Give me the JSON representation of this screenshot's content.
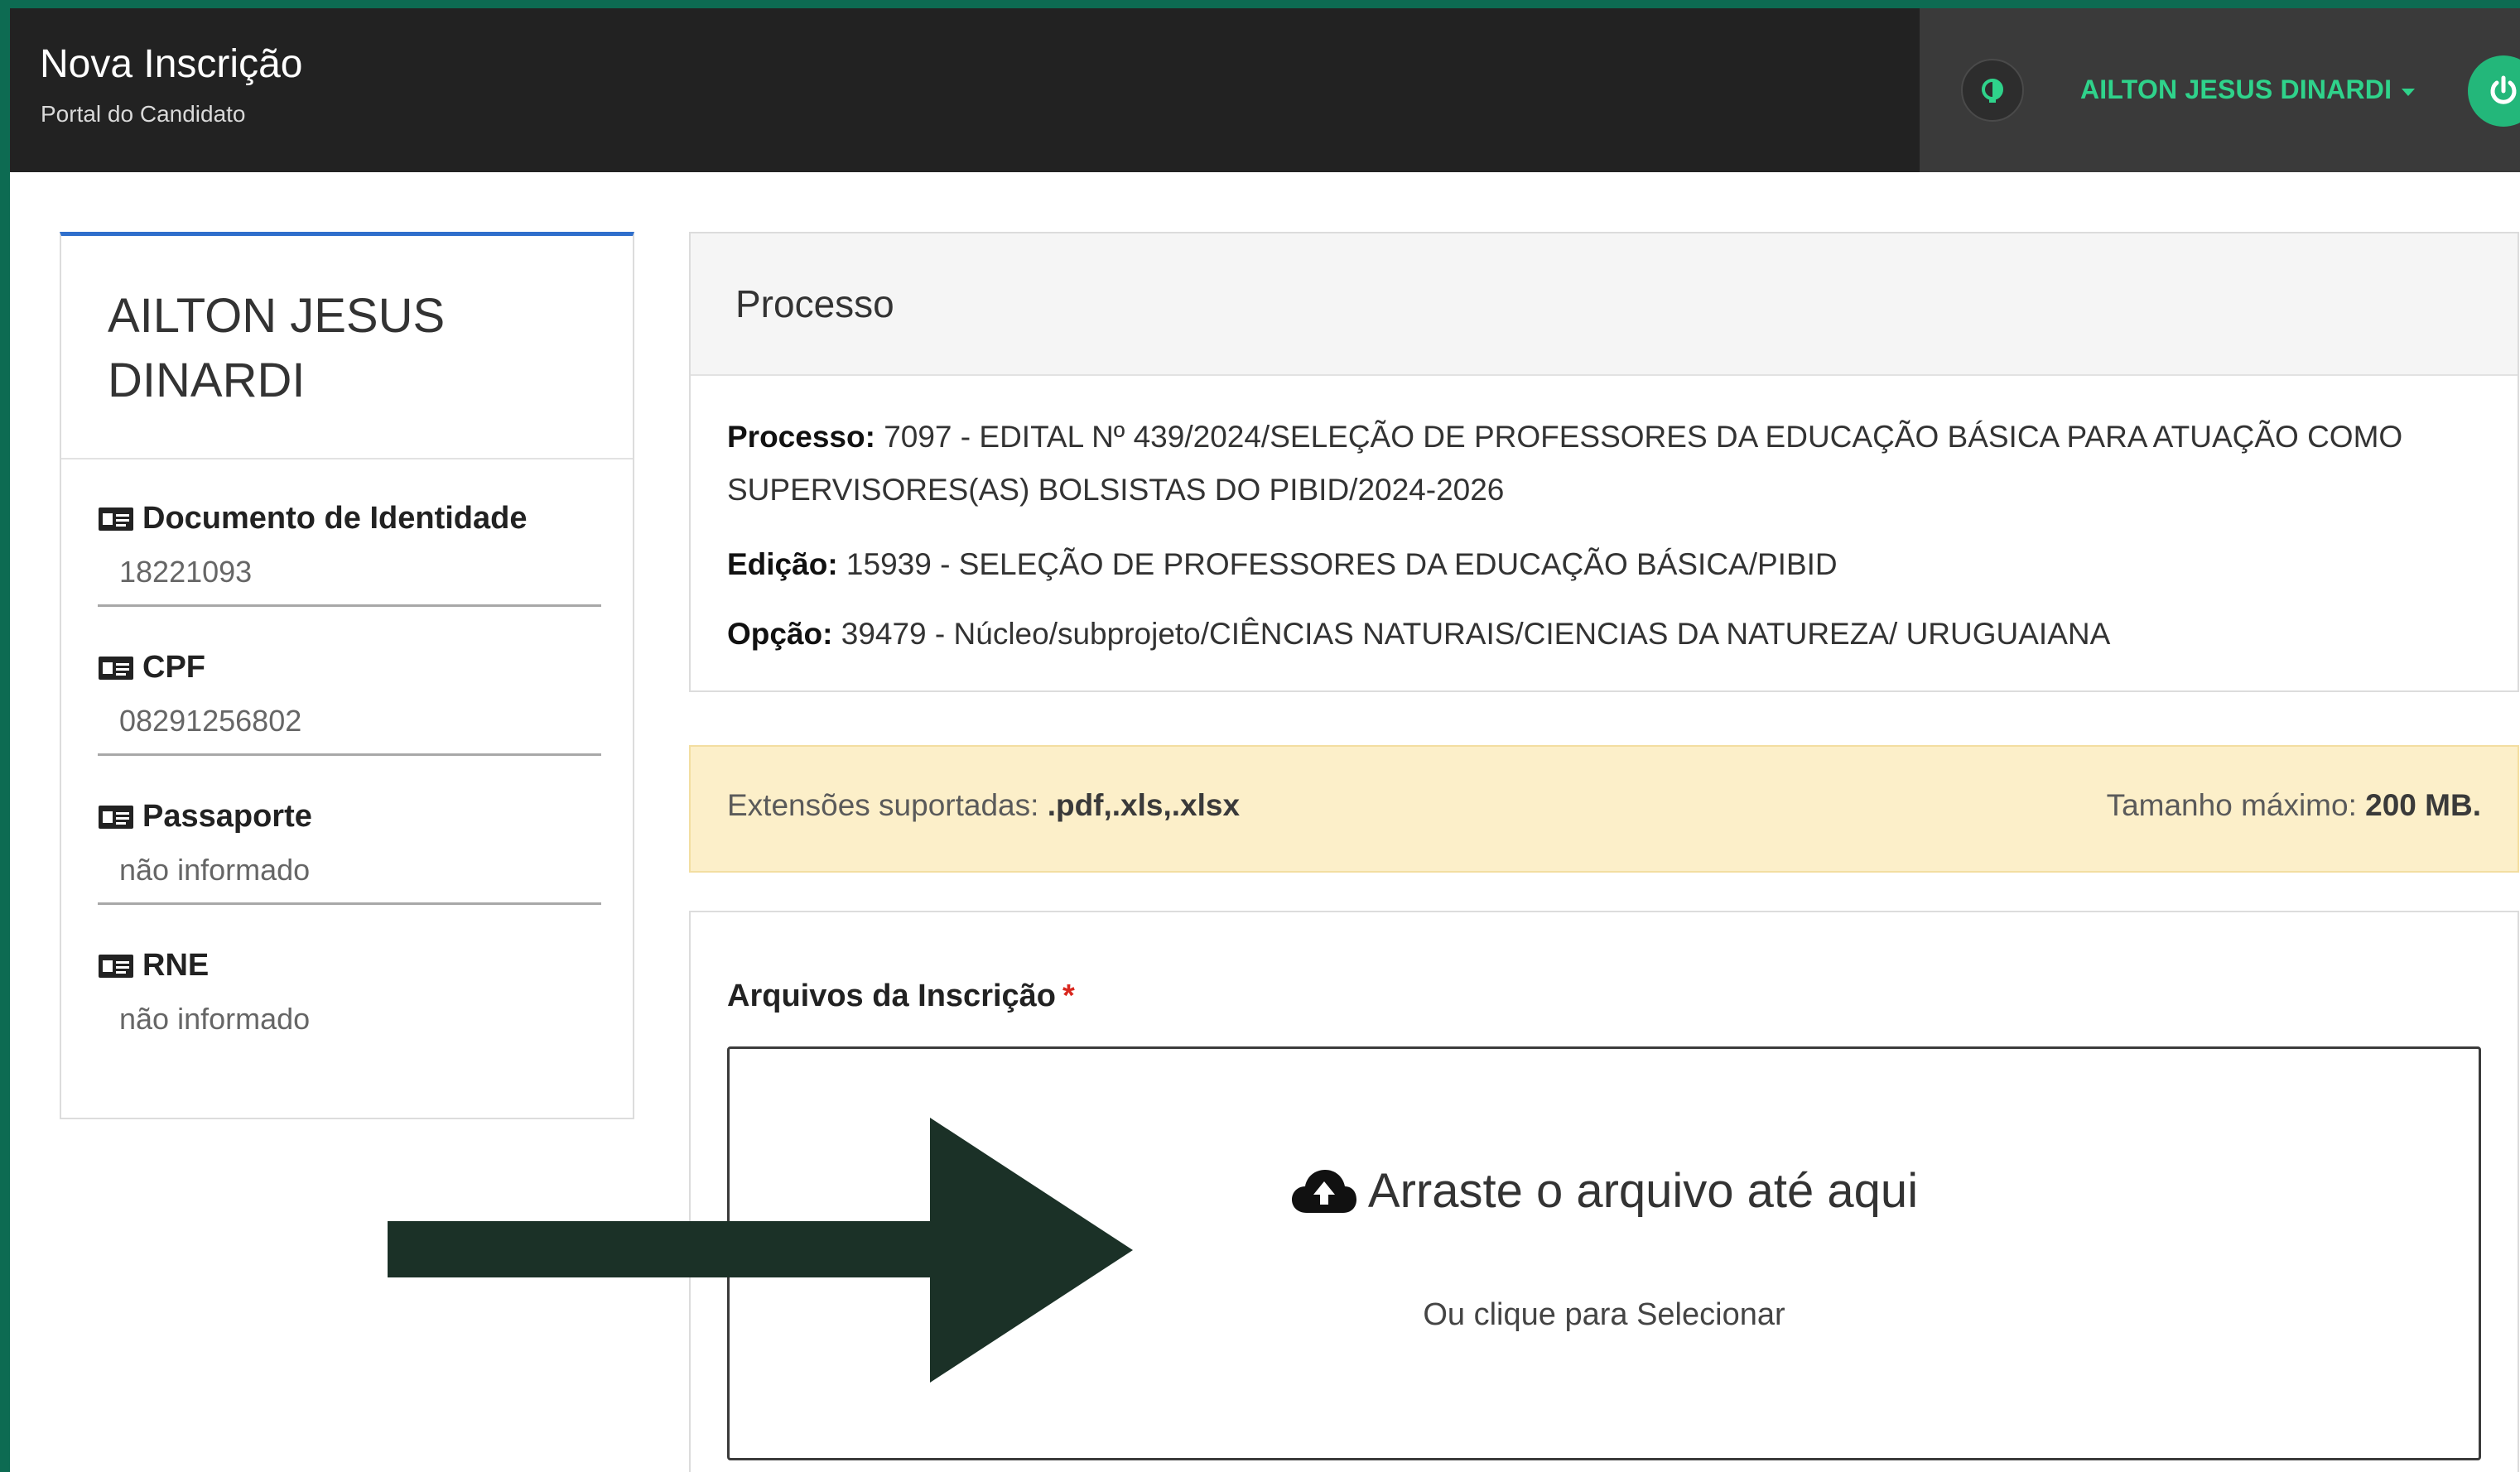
{
  "header": {
    "title": "Nova Inscrição",
    "subtitle": "Portal do Candidato",
    "user_name": "AILTON JESUS DINARDI"
  },
  "profile": {
    "name": "AILTON JESUS DINARDI",
    "fields": [
      {
        "label": "Documento de Identidade",
        "value": "18221093"
      },
      {
        "label": "CPF",
        "value": "08291256802"
      },
      {
        "label": "Passaporte",
        "value": "não informado"
      },
      {
        "label": "RNE",
        "value": "não informado"
      }
    ]
  },
  "processo": {
    "heading": "Processo",
    "processo_label": "Processo:",
    "processo_value": "7097 - EDITAL Nº 439/2024/SELEÇÃO DE PROFESSORES DA EDUCAÇÃO BÁSICA PARA ATUAÇÃO COMO SUPERVISORES(AS) BOLSISTAS DO PIBID/2024-2026",
    "edicao_label": "Edição:",
    "edicao_value": "15939 - SELEÇÃO DE PROFESSORES DA EDUCAÇÃO BÁSICA/PIBID",
    "opcao_label": "Opção:",
    "opcao_value": "39479 - Núcleo/subprojeto/CIÊNCIAS NATURAIS/CIENCIAS DA NATUREZA/ URUGUAIANA"
  },
  "upload_info": {
    "extensions_label": "Extensões suportadas:",
    "extensions_value": ".pdf,.xls,.xlsx",
    "max_size_label": "Tamanho máximo:",
    "max_size_value": "200 MB."
  },
  "files": {
    "title": "Arquivos da Inscrição",
    "required_mark": "*",
    "drop_text": "Arraste o arquivo até aqui",
    "drop_subtext": "Ou clique para Selecionar"
  },
  "colors": {
    "topbar": "#222222",
    "accent_green": "#2fd38b",
    "card_top_border": "#2f6fcc",
    "warning_bg": "#fcefc9",
    "annotation_arrow": "#1b3127"
  },
  "icons": {
    "theme": "theme-toggle-icon",
    "power": "power-icon",
    "id_card": "id-card-icon",
    "upload": "cloud-upload-icon",
    "annotation": "arrow-right-icon"
  }
}
